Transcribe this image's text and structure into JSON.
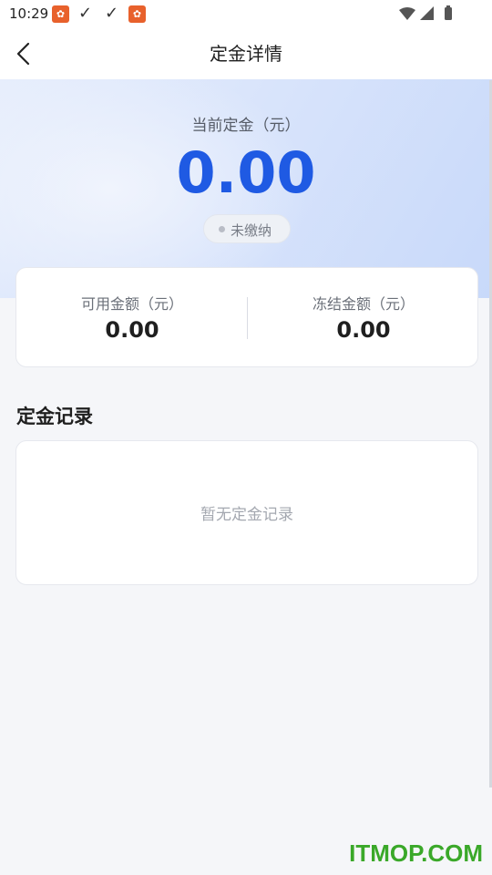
{
  "status_bar": {
    "time": "10:29",
    "notification_icons": [
      "app-notification-icon",
      "check-icon",
      "check-icon",
      "app-notification-icon"
    ],
    "right_icons": [
      "wifi-icon",
      "signal-icon",
      "battery-icon"
    ]
  },
  "header": {
    "title": "定金详情",
    "back_icon": "chevron-left-icon"
  },
  "hero": {
    "label": "当前定金（元）",
    "amount": "0.00",
    "status": "未缴纳",
    "accent_color": "#1f5ae3"
  },
  "balances": [
    {
      "label": "可用金额（元）",
      "value": "0.00"
    },
    {
      "label": "冻结金额（元）",
      "value": "0.00"
    }
  ],
  "records": {
    "title": "定金记录",
    "empty_text": "暂无定金记录"
  },
  "watermark": "ITMOP.COM"
}
